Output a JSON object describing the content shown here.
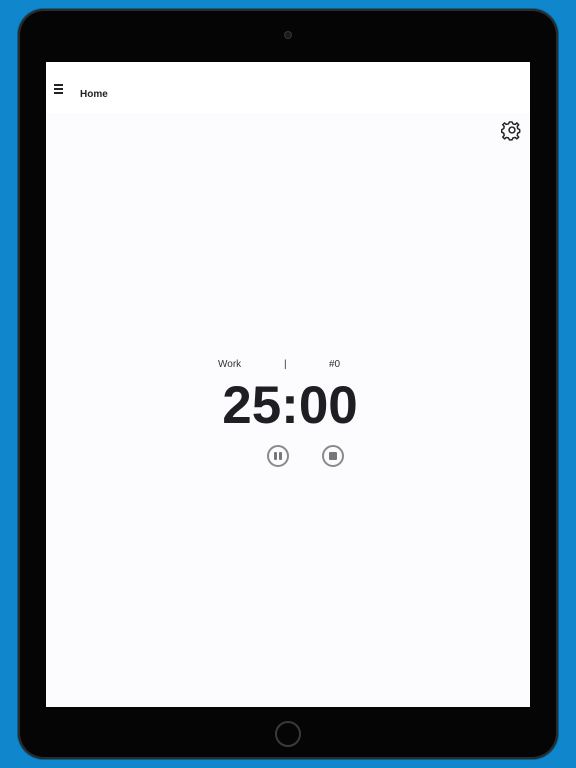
{
  "app_bar": {
    "title": "Home",
    "menu_icon": "hamburger-menu-icon",
    "settings_icon": "settings-gear-icon"
  },
  "timer": {
    "session_type": "Work",
    "separator": "|",
    "session_count": "#0",
    "time_remaining": "25:00"
  },
  "controls": {
    "pause_icon": "pause-icon",
    "stop_icon": "stop-icon"
  },
  "colors": {
    "background": "#1086cc",
    "device": "#050505",
    "screen": "#fcfbfd",
    "text": "#1e1e23",
    "control_gray": "#8a8a8a"
  }
}
